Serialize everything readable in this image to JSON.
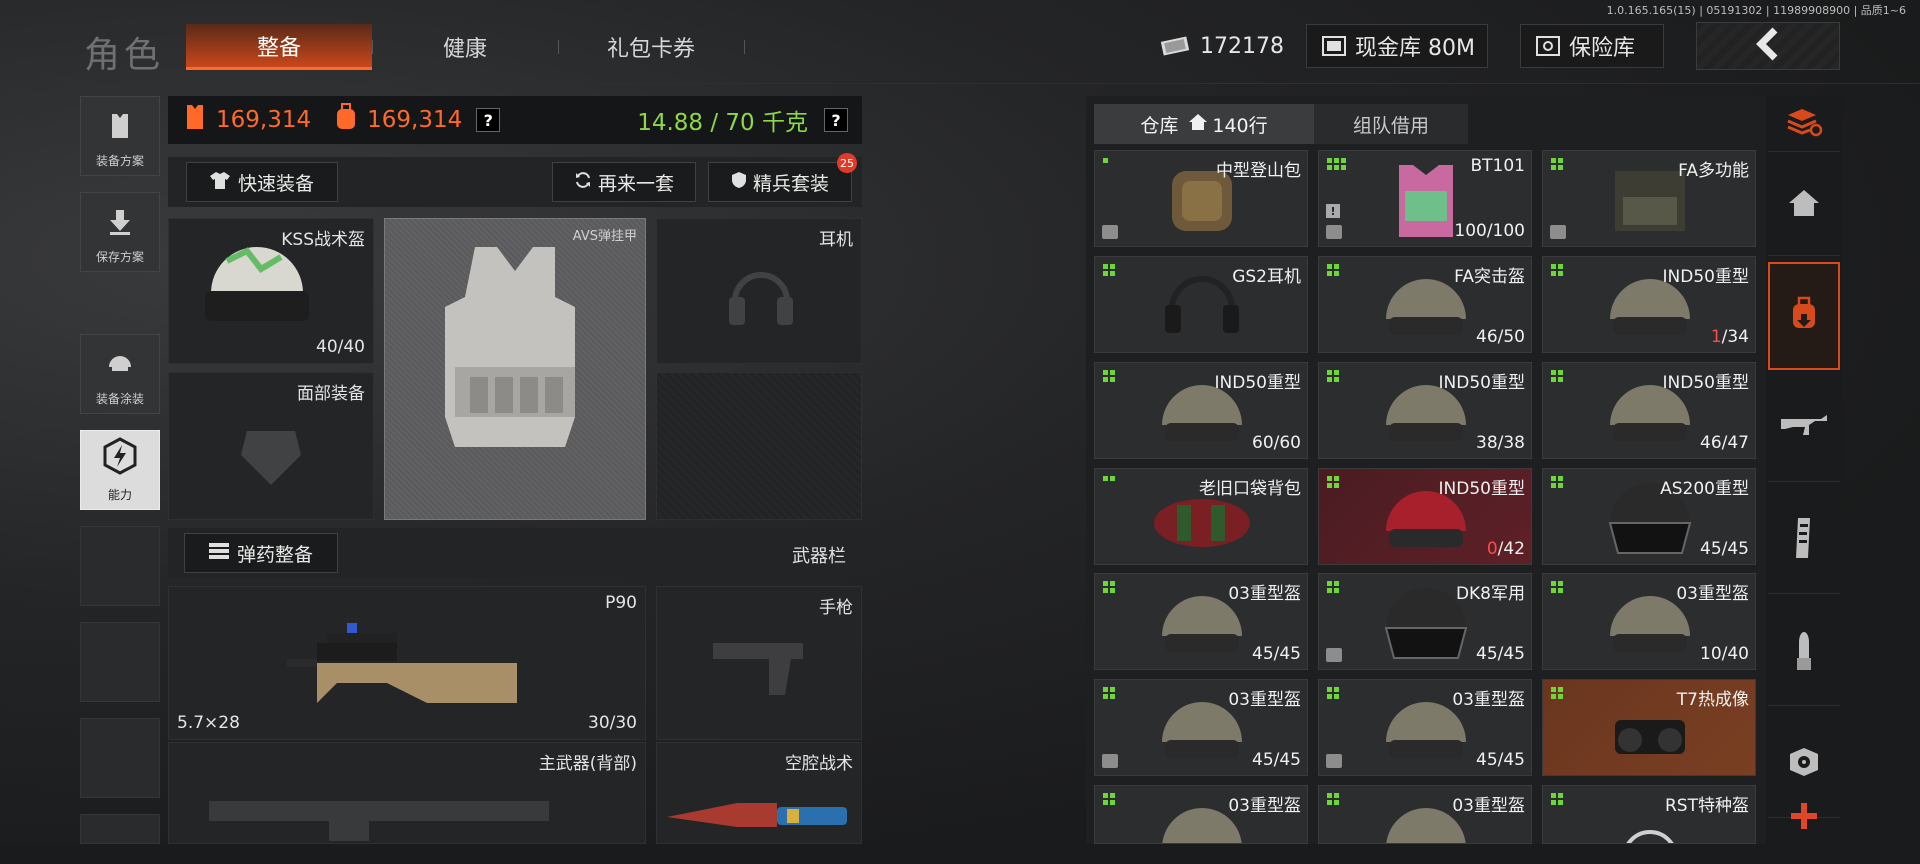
{
  "version": "1.0.165.165(15) | 05191302 | 11989908900 | 品质1~6",
  "header": {
    "title": "角色",
    "tabs": [
      {
        "label": "整备",
        "active": true
      },
      {
        "label": "健康",
        "active": false
      },
      {
        "label": "礼包卡券",
        "active": false
      }
    ],
    "cash": "172178",
    "cash_vault": "现金库 80M",
    "safe": "保险库",
    "back_icon": "chevron-left-icon"
  },
  "left_tools": [
    {
      "label": "装备方案",
      "icon": "vest-icon"
    },
    {
      "label": "保存方案",
      "icon": "download-icon"
    },
    {
      "label": "装备涂装",
      "icon": "helmet-paint-icon"
    },
    {
      "label": "能力",
      "icon": "ability-icon"
    }
  ],
  "stats": {
    "armor_value": "169,314",
    "bag_value": "169,314",
    "help": "?",
    "weight": "14.88 / 70 千克",
    "weight_help": "?"
  },
  "actions": {
    "quick_equip": "快速装备",
    "again": "再来一套",
    "elite": "精兵套装",
    "elite_badge": "25"
  },
  "slots": {
    "helmet": {
      "label": "KSS战术盔",
      "durability": "40/40"
    },
    "armor": {
      "label": "AVS弹挂甲"
    },
    "headset": {
      "label": "耳机"
    },
    "face": {
      "label": "面部装备"
    },
    "ammo_btn": "弹药整备",
    "weapon_bar": "武器栏",
    "primary": {
      "label": "P90",
      "caliber": "5.7×28",
      "ammo": "30/30"
    },
    "pistol": {
      "label": "手枪"
    },
    "secondary": {
      "label": "主武器(背部)"
    },
    "melee": {
      "label": "空腔战术"
    }
  },
  "inventory": {
    "tab_storage": "仓库",
    "tab_rows": "140行",
    "tab_team": "组队借用",
    "items": [
      {
        "name": "中型登山包",
        "dur": "",
        "lo": "",
        "size": 1,
        "ins": true,
        "bg": "normal"
      },
      {
        "name": "BT101",
        "dur": "100/100",
        "lo": "",
        "size": 6,
        "ins": true,
        "ex": true,
        "bg": "normal"
      },
      {
        "name": "FA多功能",
        "dur": "",
        "lo": "",
        "size": 4,
        "ins": true,
        "bg": "normal"
      },
      {
        "name": "GS2耳机",
        "dur": "",
        "lo": "",
        "size": 4,
        "ins": false,
        "bg": "normal"
      },
      {
        "name": "FA突击盔",
        "dur": "46/50",
        "lo": "",
        "size": 4,
        "ins": false,
        "bg": "normal"
      },
      {
        "name": "IND50重型",
        "dur": "/34",
        "lo": "1",
        "size": 4,
        "ins": false,
        "bg": "normal"
      },
      {
        "name": "IND50重型",
        "dur": "60/60",
        "lo": "",
        "size": 4,
        "ins": false,
        "bg": "normal"
      },
      {
        "name": "IND50重型",
        "dur": "38/38",
        "lo": "",
        "size": 4,
        "ins": false,
        "bg": "normal"
      },
      {
        "name": "IND50重型",
        "dur": "46/47",
        "lo": "",
        "size": 4,
        "ins": false,
        "bg": "normal"
      },
      {
        "name": "老旧口袋背包",
        "dur": "",
        "lo": "",
        "size": 2,
        "ins": false,
        "bg": "normal"
      },
      {
        "name": "IND50重型",
        "dur": "/42",
        "lo": "0",
        "size": 4,
        "ins": false,
        "bg": "red"
      },
      {
        "name": "AS200重型",
        "dur": "45/45",
        "lo": "",
        "size": 4,
        "ins": false,
        "bg": "normal"
      },
      {
        "name": "03重型盔",
        "dur": "45/45",
        "lo": "",
        "size": 4,
        "ins": false,
        "bg": "normal"
      },
      {
        "name": "DK8军用",
        "dur": "45/45",
        "lo": "",
        "size": 4,
        "ins": true,
        "bg": "normal"
      },
      {
        "name": "03重型盔",
        "dur": "10/40",
        "lo": "",
        "size": 4,
        "ins": false,
        "bg": "normal"
      },
      {
        "name": "03重型盔",
        "dur": "45/45",
        "lo": "",
        "size": 4,
        "ins": true,
        "bg": "normal"
      },
      {
        "name": "03重型盔",
        "dur": "45/45",
        "lo": "",
        "size": 4,
        "ins": true,
        "bg": "normal"
      },
      {
        "name": "T7热成像",
        "dur": "",
        "lo": "",
        "size": 4,
        "ins": false,
        "bg": "orange"
      },
      {
        "name": "03重型盔",
        "dur": "",
        "lo": "",
        "size": 4,
        "ins": false,
        "bg": "normal"
      },
      {
        "name": "03重型盔",
        "dur": "",
        "lo": "",
        "size": 4,
        "ins": false,
        "bg": "normal"
      },
      {
        "name": "RST特种盔",
        "dur": "",
        "lo": "",
        "size": 4,
        "ins": false,
        "bg": "normal"
      }
    ]
  },
  "categories": [
    {
      "icon": "layers-refresh-icon",
      "active": false
    },
    {
      "icon": "home-icon",
      "active": false
    },
    {
      "icon": "backpack-icon",
      "active": true
    },
    {
      "icon": "rifle-icon",
      "active": false
    },
    {
      "icon": "magazine-icon",
      "active": false
    },
    {
      "icon": "bullet-icon",
      "active": false
    },
    {
      "icon": "scope-icon",
      "active": false
    },
    {
      "icon": "plus-icon",
      "active": false
    }
  ],
  "colors": {
    "accent": "#d84a1c",
    "weight_green": "#8ed846",
    "value_orange": "#ff6a2a",
    "size_green": "#6fd63a"
  }
}
